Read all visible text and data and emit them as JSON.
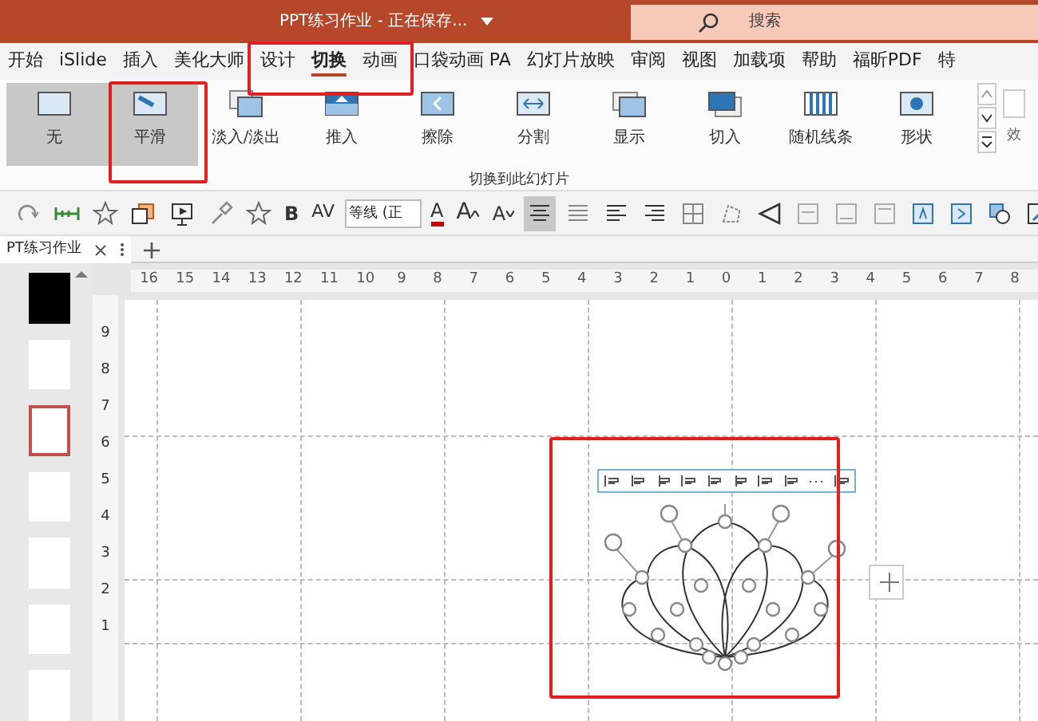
{
  "title_bar": {
    "title": "PPT练习作业  -  正在保存...",
    "search": {
      "placeholder": "搜索"
    }
  },
  "ribbon_tabs": [
    {
      "label": "开始",
      "selected": false
    },
    {
      "label": "iSlide",
      "selected": false
    },
    {
      "label": "插入",
      "selected": false
    },
    {
      "label": "美化大师",
      "selected": false
    },
    {
      "label": "设计",
      "selected": false
    },
    {
      "label": "切换",
      "selected": true
    },
    {
      "label": "动画",
      "selected": false
    },
    {
      "label": "口袋动画 PA",
      "selected": false
    },
    {
      "label": "幻灯片放映",
      "selected": false
    },
    {
      "label": "审阅",
      "selected": false
    },
    {
      "label": "视图",
      "selected": false
    },
    {
      "label": "加载项",
      "selected": false
    },
    {
      "label": "帮助",
      "selected": false
    },
    {
      "label": "福昕PDF",
      "selected": false
    },
    {
      "label": "特",
      "selected": false
    }
  ],
  "transitions": [
    {
      "label": "无",
      "highlighted": true
    },
    {
      "label": "平滑",
      "highlighted": true
    },
    {
      "label": "淡入/淡出",
      "highlighted": false
    },
    {
      "label": "推入",
      "highlighted": false
    },
    {
      "label": "擦除",
      "highlighted": false
    },
    {
      "label": "分割",
      "highlighted": false
    },
    {
      "label": "显示",
      "highlighted": false
    },
    {
      "label": "切入",
      "highlighted": false
    },
    {
      "label": "随机线条",
      "highlighted": false
    },
    {
      "label": "形状",
      "highlighted": false
    }
  ],
  "effect_options": {
    "label": "效"
  },
  "group_label": "切换到此幻灯片",
  "toolbar": [
    {
      "kind": "icon",
      "active": false
    },
    {
      "kind": "icon",
      "active": false
    },
    {
      "kind": "icon",
      "active": false
    },
    {
      "kind": "icon",
      "active": false
    },
    {
      "kind": "icon",
      "active": false
    },
    {
      "kind": "icon",
      "active": false
    },
    {
      "kind": "icon",
      "active": false
    },
    {
      "kind": "text",
      "label": "B"
    },
    {
      "kind": "text",
      "label": "AV"
    },
    {
      "kind": "field",
      "value": "等线 (正"
    },
    {
      "kind": "text",
      "label": "A"
    },
    {
      "kind": "text",
      "label": "A"
    },
    {
      "kind": "text",
      "label": "A"
    },
    {
      "kind": "icon",
      "active": true
    },
    {
      "kind": "icon",
      "active": false
    },
    {
      "kind": "icon",
      "active": false
    },
    {
      "kind": "icon",
      "active": false
    },
    {
      "kind": "icon",
      "active": false
    },
    {
      "kind": "icon",
      "active": false
    },
    {
      "kind": "icon",
      "active": false
    },
    {
      "kind": "icon",
      "active": false
    },
    {
      "kind": "icon",
      "active": false
    },
    {
      "kind": "icon",
      "active": false
    },
    {
      "kind": "icon",
      "active": false
    },
    {
      "kind": "icon",
      "active": false
    },
    {
      "kind": "icon",
      "active": false
    },
    {
      "kind": "icon",
      "active": false
    }
  ],
  "document_tab": {
    "title": "PT练习作业"
  },
  "slides": [
    {
      "dark": true,
      "selected": false
    },
    {
      "dark": false,
      "selected": false
    },
    {
      "dark": false,
      "selected": true
    },
    {
      "dark": false,
      "selected": false
    },
    {
      "dark": false,
      "selected": false
    },
    {
      "dark": false,
      "selected": false
    },
    {
      "dark": false,
      "selected": false
    }
  ],
  "rulers": {
    "horizontal": [
      "16",
      "15",
      "14",
      "13",
      "12",
      "11",
      "10",
      "9",
      "8",
      "7",
      "6",
      "5",
      "4",
      "3",
      "2",
      "1",
      "0",
      "1",
      "2",
      "3",
      "4",
      "5",
      "6",
      "7",
      "8"
    ],
    "vertical": [
      "9",
      "8",
      "7",
      "6",
      "5",
      "4",
      "3",
      "2",
      "1"
    ]
  }
}
